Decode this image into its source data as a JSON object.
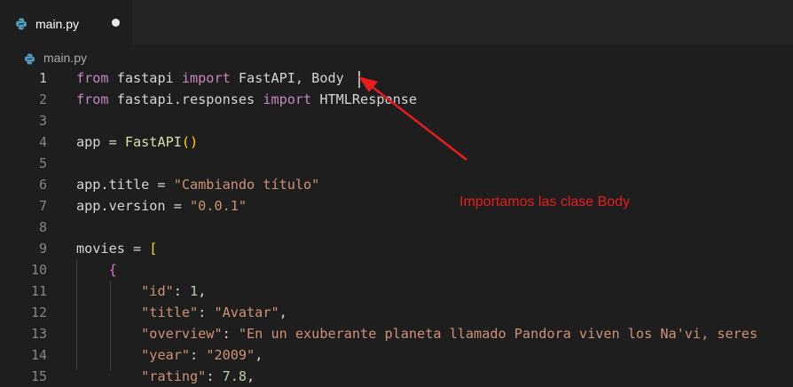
{
  "tab": {
    "filename": "main.py",
    "unsaved": true
  },
  "breadcrumb": {
    "filename": "main.py"
  },
  "editor": {
    "active_line": 1,
    "lines": [
      {
        "n": "1",
        "tokens": [
          {
            "t": "from",
            "c": "kw"
          },
          {
            "t": " fastapi ",
            "c": ""
          },
          {
            "t": "import",
            "c": "kw"
          },
          {
            "t": " FastAPI, Body",
            "c": ""
          }
        ]
      },
      {
        "n": "2",
        "tokens": [
          {
            "t": "from",
            "c": "kw"
          },
          {
            "t": " fastapi.responses ",
            "c": ""
          },
          {
            "t": "import",
            "c": "kw"
          },
          {
            "t": " HTMLResponse",
            "c": ""
          }
        ]
      },
      {
        "n": "3",
        "tokens": []
      },
      {
        "n": "4",
        "tokens": [
          {
            "t": "app = ",
            "c": ""
          },
          {
            "t": "FastAPI",
            "c": "fn"
          },
          {
            "t": "()",
            "c": "br1"
          }
        ]
      },
      {
        "n": "5",
        "tokens": []
      },
      {
        "n": "6",
        "tokens": [
          {
            "t": "app.title = ",
            "c": ""
          },
          {
            "t": "\"Cambiando título\"",
            "c": "str"
          }
        ]
      },
      {
        "n": "7",
        "tokens": [
          {
            "t": "app.version = ",
            "c": ""
          },
          {
            "t": "\"0.0.1\"",
            "c": "str"
          }
        ]
      },
      {
        "n": "8",
        "tokens": []
      },
      {
        "n": "9",
        "tokens": [
          {
            "t": "movies = ",
            "c": ""
          },
          {
            "t": "[",
            "c": "br1"
          }
        ]
      },
      {
        "n": "10",
        "tokens": [
          {
            "t": "    ",
            "c": ""
          },
          {
            "t": "{",
            "c": "br2"
          }
        ]
      },
      {
        "n": "11",
        "tokens": [
          {
            "t": "        ",
            "c": ""
          },
          {
            "t": "\"id\"",
            "c": "str"
          },
          {
            "t": ": ",
            "c": ""
          },
          {
            "t": "1",
            "c": "num"
          },
          {
            "t": ",",
            "c": ""
          }
        ]
      },
      {
        "n": "12",
        "tokens": [
          {
            "t": "        ",
            "c": ""
          },
          {
            "t": "\"title\"",
            "c": "str"
          },
          {
            "t": ": ",
            "c": ""
          },
          {
            "t": "\"Avatar\"",
            "c": "str"
          },
          {
            "t": ",",
            "c": ""
          }
        ]
      },
      {
        "n": "13",
        "tokens": [
          {
            "t": "        ",
            "c": ""
          },
          {
            "t": "\"overview\"",
            "c": "str"
          },
          {
            "t": ": ",
            "c": ""
          },
          {
            "t": "\"En un exuberante planeta llamado Pandora viven los Na'vi, seres",
            "c": "str"
          }
        ]
      },
      {
        "n": "14",
        "tokens": [
          {
            "t": "        ",
            "c": ""
          },
          {
            "t": "\"year\"",
            "c": "str"
          },
          {
            "t": ": ",
            "c": ""
          },
          {
            "t": "\"2009\"",
            "c": "str"
          },
          {
            "t": ",",
            "c": ""
          }
        ]
      },
      {
        "n": "15",
        "tokens": [
          {
            "t": "        ",
            "c": ""
          },
          {
            "t": "\"rating\"",
            "c": "str"
          },
          {
            "t": ": ",
            "c": ""
          },
          {
            "t": "7.8",
            "c": "num"
          },
          {
            "t": ",",
            "c": ""
          }
        ]
      }
    ]
  },
  "annotation": {
    "text": "Importamos las clase Body",
    "color": "#e61d1d"
  },
  "icons": {
    "tab_icon": "python-icon",
    "breadcrumb_icon": "python-icon"
  }
}
